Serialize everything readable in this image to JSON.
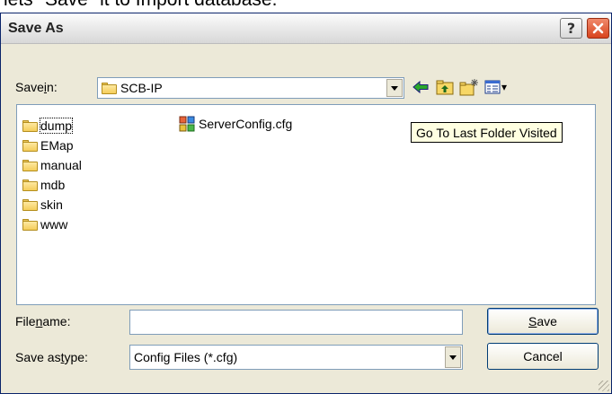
{
  "background": {
    "caption": "lets \"Save\" it to Import database."
  },
  "window": {
    "title": "Save As"
  },
  "titlebar_buttons": {
    "help_label": "?"
  },
  "save_in": {
    "label_pre": "Save ",
    "label_key": "i",
    "label_post": "n:",
    "value": "SCB-IP"
  },
  "toolbar": {
    "view_menu_arrow": "▾"
  },
  "tooltip": {
    "text": "Go To Last Folder Visited"
  },
  "file_list": {
    "folders": [
      "dump",
      "EMap",
      "manual",
      "mdb",
      "skin",
      "www"
    ],
    "files": [
      "ServerConfig.cfg"
    ]
  },
  "filename": {
    "label_pre": "File ",
    "label_key": "n",
    "label_post": "ame:",
    "value": ""
  },
  "savetype": {
    "label_pre": "Save as ",
    "label_key": "t",
    "label_post": "ype:",
    "value": "Config Files (*.cfg)"
  },
  "buttons": {
    "save_key": "S",
    "save_rest": "ave",
    "cancel": "Cancel"
  }
}
